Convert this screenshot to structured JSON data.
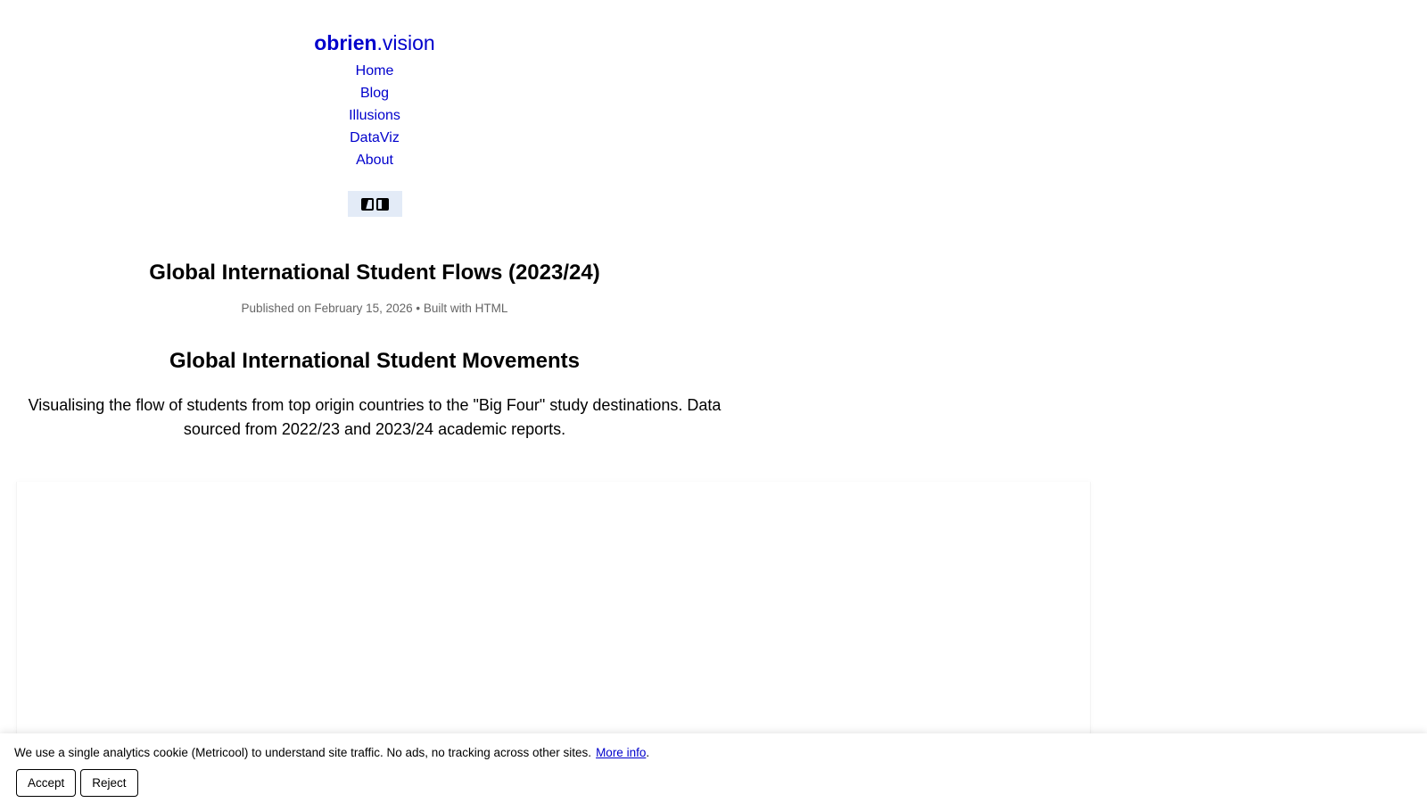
{
  "header": {
    "brand_bold": "obrien",
    "brand_rest": ".vision",
    "nav": [
      {
        "label": "Home"
      },
      {
        "label": "Blog"
      },
      {
        "label": "Illusions"
      },
      {
        "label": "DataViz"
      },
      {
        "label": "About"
      }
    ],
    "theme_toggle_icons": [
      "contrast-dark-icon",
      "contrast-light-icon"
    ]
  },
  "article": {
    "title": "Global International Student Flows (2023/24)",
    "meta": "Published on February 15, 2026 • Built with HTML",
    "section_title": "Global International Student Movements",
    "description": "Visualising the flow of students from top origin countries to the \"Big Four\" study destinations. Data sourced from 2022/23 and 2023/24 academic reports."
  },
  "cookie_banner": {
    "text": "We use a single analytics cookie (Metricool) to understand site traffic. No ads, no tracking across other sites.",
    "link_label": "More info",
    "trailing": ".",
    "accept_label": "Accept",
    "reject_label": "Reject"
  },
  "colors": {
    "link": "#0000cc",
    "toggle_bg": "#e3ebf7",
    "meta_text": "#666666"
  }
}
